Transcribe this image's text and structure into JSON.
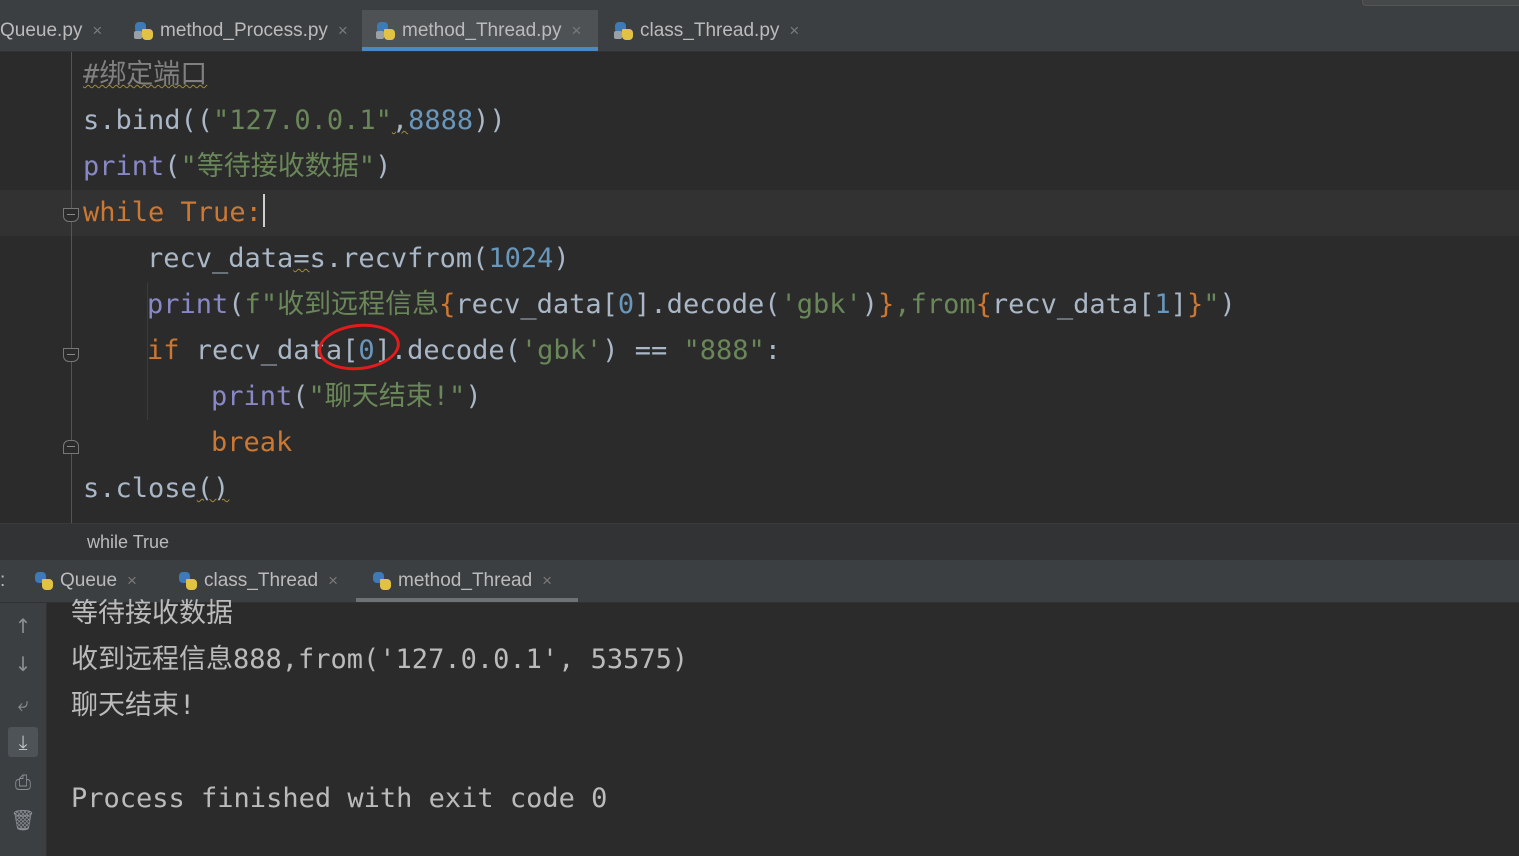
{
  "editor_tabs": [
    {
      "label": "Queue.py",
      "active": false
    },
    {
      "label": "method_Process.py",
      "active": false
    },
    {
      "label": "method_Thread.py",
      "active": true
    },
    {
      "label": "class_Thread.py",
      "active": false
    }
  ],
  "tab_close_glyph": "×",
  "code": {
    "line1_comment": "#绑定端口",
    "line2_a": "s.bind((",
    "line2_str": "\"127.0.0.1\"",
    "line2_comma": ",",
    "line2_num": "8888",
    "line2_end": "))",
    "line3_fn": "print",
    "line3_open": "(",
    "line3_str": "\"等待接收数据\"",
    "line3_close": ")",
    "line4_kw1": "while",
    "line4_kw2": "True",
    "line4_colon": ":",
    "line5_a": "recv_data",
    "line5_eq": "=",
    "line5_b": "s.recvfrom(",
    "line5_num": "1024",
    "line5_c": ")",
    "line6_fn": "print",
    "line6_open": "(",
    "line6_f": "f",
    "line6_str1": "\"收到远程信息",
    "line6_br1": "{",
    "line6_expr1": "recv_data[",
    "line6_num1": "0",
    "line6_expr1b": "].decode(",
    "line6_str2": "'gbk'",
    "line6_expr1c": ")",
    "line6_br2": "}",
    "line6_str3": ",from",
    "line6_br3": "{",
    "line6_expr2": "recv_data[",
    "line6_num2": "1",
    "line6_expr2b": "]",
    "line6_br4": "}",
    "line6_str4": "\"",
    "line6_close": ")",
    "line7_kw": "if",
    "line7_a": " recv_data[",
    "line7_num": "0",
    "line7_b": "].decode(",
    "line7_str": "'gbk'",
    "line7_c": ") == ",
    "line7_str2": "\"888\"",
    "line7_d": ":",
    "line8_fn": "print",
    "line8_open": "(",
    "line8_str": "\"聊天结束!\"",
    "line8_close": ")",
    "line9_kw": "break",
    "line10_a": "s.close",
    "line10_b": "()"
  },
  "breadcrumb": "while True",
  "run_prefix": ":",
  "run_tabs": [
    {
      "label": "Queue",
      "active": false
    },
    {
      "label": "class_Thread",
      "active": false
    },
    {
      "label": "method_Thread",
      "active": true
    }
  ],
  "console_output": [
    "等待接收数据",
    "收到远程信息888,from('127.0.0.1', 53575)",
    "聊天结束!",
    "",
    "Process finished with exit code 0"
  ],
  "toolbar_icons": [
    "arrow-up-icon",
    "arrow-down-icon",
    "soft-wrap-icon",
    "scroll-to-end-icon",
    "print-icon",
    "trash-icon"
  ],
  "colors": {
    "keyword": "#cc7832",
    "builtin": "#8888c6",
    "string": "#6a8759",
    "number": "#6897bb",
    "comment": "#808080",
    "annotation_circle": "#e21b1b",
    "active_tab_underline": "#4a88c7"
  }
}
